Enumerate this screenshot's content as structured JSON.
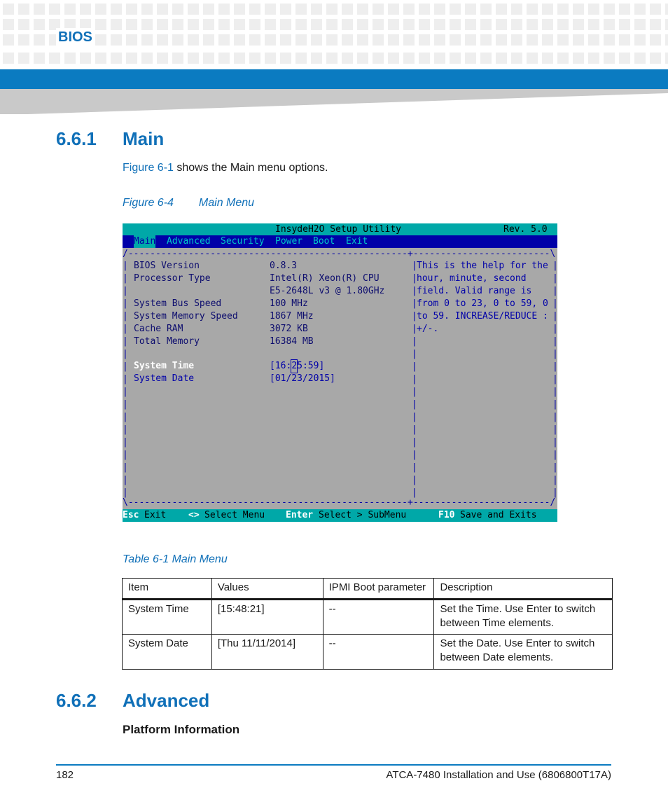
{
  "header": {
    "section_label": "BIOS"
  },
  "section_main": {
    "number": "6.6.1",
    "title": "Main",
    "intro_link": "Figure 6-1",
    "intro_text": " shows the Main menu options.",
    "figure_number": "Figure 6-4",
    "figure_title": "Main Menu"
  },
  "bios_screen": {
    "utility_title": "InsydeH2O Setup Utility",
    "revision": "Rev. 5.0",
    "menu": [
      "Main",
      "Advanced",
      "Security",
      "Power",
      "Boot",
      "Exit"
    ],
    "active_menu": "Main",
    "items": [
      {
        "label": "BIOS Version",
        "value": "0.8.3"
      },
      {
        "label": "Processor Type",
        "value": "Intel(R) Xeon(R) CPU"
      },
      {
        "label": "",
        "value": "E5-2648L v3 @ 1.80GHz"
      },
      {
        "label": "System Bus Speed",
        "value": "100 MHz"
      },
      {
        "label": "System Memory Speed",
        "value": "1867 MHz"
      },
      {
        "label": "Cache RAM",
        "value": "3072 KB"
      },
      {
        "label": "Total Memory",
        "value": "16384 MB"
      }
    ],
    "system_time": {
      "label": "System Time",
      "value_pre": "[16:",
      "value_cursor": "2",
      "value_post": "5:59]"
    },
    "system_date": {
      "label": "System Date",
      "value": "[01/23/2015]"
    },
    "help_lines": [
      "This is the help for the",
      "hour, minute, second",
      "field. Valid range is",
      "from 0 to 23, 0 to 59, 0",
      "to 59. INCREASE/REDUCE :",
      "+/-."
    ],
    "footer": [
      {
        "key": "Esc",
        "action": "Exit"
      },
      {
        "key": "<>",
        "action": "Select Menu"
      },
      {
        "key": "Enter",
        "action": "Select > SubMenu"
      },
      {
        "key": "F10",
        "action": "Save and Exits"
      }
    ]
  },
  "table": {
    "caption": "Table 6-1 Main Menu",
    "headers": [
      "Item",
      "Values",
      "IPMI Boot parameter",
      "Description"
    ],
    "rows": [
      [
        "System Time",
        "[15:48:21]",
        "--",
        "Set the Time. Use Enter to switch between Time elements."
      ],
      [
        "System Date",
        "[Thu 11/11/2014]",
        "--",
        "Set the Date. Use Enter to switch between Date elements."
      ]
    ]
  },
  "section_advanced": {
    "number": "6.6.2",
    "title": "Advanced",
    "subheading": "Platform Information"
  },
  "footer": {
    "page_number": "182",
    "document": "ATCA-7480 Installation and Use (6806800T17A)"
  },
  "colors": {
    "brand_blue": "#1070b8",
    "bar_blue": "#0b7bc1",
    "bios_gray": "#a8a8a8",
    "bios_cyan": "#00a8a8",
    "bios_navy": "#0000a8"
  }
}
